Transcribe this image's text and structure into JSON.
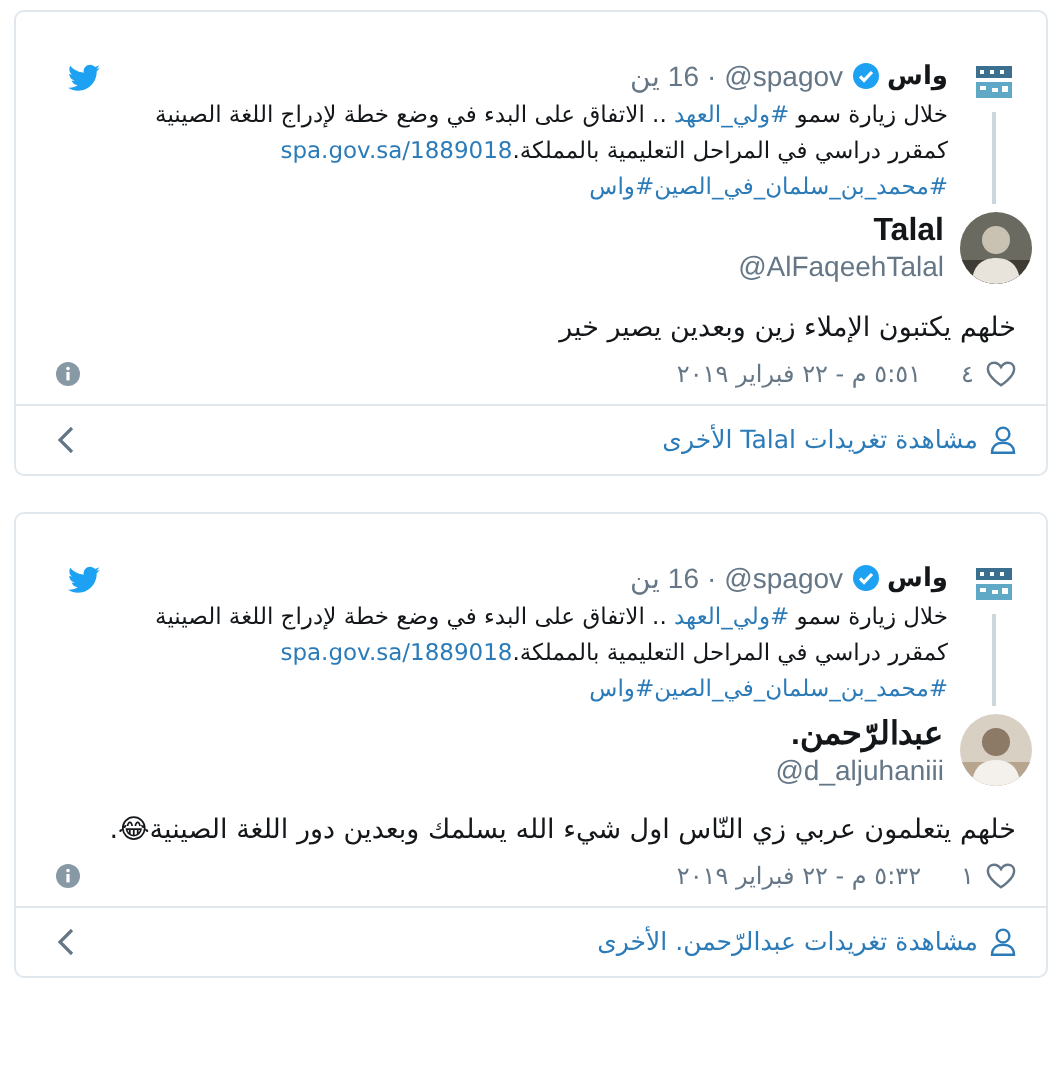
{
  "cards": [
    {
      "quote": {
        "name": "واس",
        "verified": true,
        "handle": "@spagov",
        "dot": "·",
        "date": "16 ين",
        "segments": [
          {
            "kind": "text",
            "text": "خلال زيارة سمو "
          },
          {
            "kind": "link",
            "text": "#ولي_العهد"
          },
          {
            "kind": "text",
            "text": " .. الاتفاق على البدء في وضع خطة لإدراج اللغة الصينية كمقرر دراسي في المراحل التعليمية بالمملكة."
          },
          {
            "kind": "link",
            "text": "spa.gov.sa/1889018"
          },
          {
            "kind": "link",
            "text": "#محمد_بن_سلمان_في_الصين"
          },
          {
            "kind": "link",
            "text": "#واس"
          }
        ]
      },
      "author": {
        "name": "Talal",
        "handle": "@AlFaqeehTalal"
      },
      "text": "خلهم يكتبون الإملاء زين وبعدين يصير خير",
      "likes": "٤",
      "time": "٥:٥١ م - ٢٢ فبراير ٢٠١٩",
      "more": "مشاهدة تغريدات Talal الأخرى"
    },
    {
      "quote": {
        "name": "واس",
        "verified": true,
        "handle": "@spagov",
        "dot": "·",
        "date": "16 ين",
        "segments": [
          {
            "kind": "text",
            "text": "خلال زيارة سمو "
          },
          {
            "kind": "link",
            "text": "#ولي_العهد"
          },
          {
            "kind": "text",
            "text": " .. الاتفاق على البدء في وضع خطة لإدراج اللغة الصينية كمقرر دراسي في المراحل التعليمية بالمملكة."
          },
          {
            "kind": "link",
            "text": "spa.gov.sa/1889018"
          },
          {
            "kind": "link",
            "text": "#محمد_بن_سلمان_في_الصين"
          },
          {
            "kind": "link",
            "text": "#واس"
          }
        ]
      },
      "author": {
        "name": "عبدالرّحمن.",
        "handle": "@d_aljuhaniii"
      },
      "text": "خلهم يتعلمون عربي زي النّاس اول شيء الله يسلمك وبعدين دور اللغة الصينية😂.",
      "likes": "١",
      "time": "٥:٣٢ م - ٢٢ فبراير ٢٠١٩",
      "more": "مشاهدة تغريدات عبدالرّحمن. الأخرى"
    }
  ]
}
